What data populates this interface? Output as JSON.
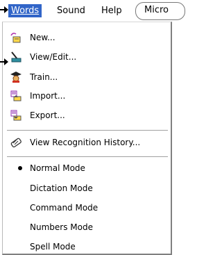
{
  "menubar": {
    "words": "Words",
    "sound": "Sound",
    "help": "Help",
    "micro": "Micro"
  },
  "menu": {
    "new": "New...",
    "view_edit": "View/Edit...",
    "train": "Train...",
    "import": "Import...",
    "export": "Export...",
    "view_history": "View Recognition History...",
    "modes": {
      "normal": "Normal Mode",
      "dictation": "Dictation Mode",
      "command": "Command Mode",
      "numbers": "Numbers Mode",
      "spell": "Spell Mode"
    }
  },
  "colors": {
    "menu_highlight": "#3165c8",
    "menu_bg": "#ffffff"
  }
}
